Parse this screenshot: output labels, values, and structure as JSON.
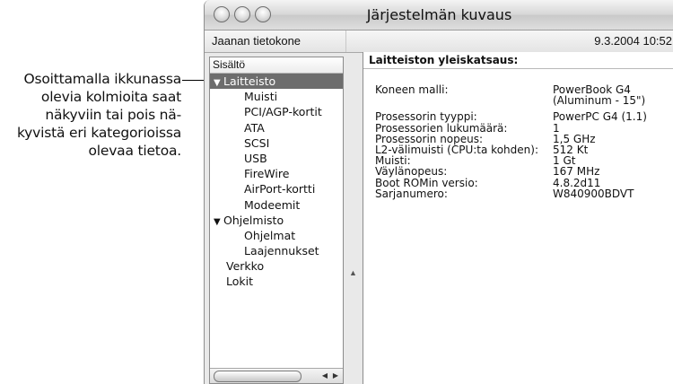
{
  "callout": {
    "lines": [
      "Osoittamalla ikkunassa",
      "olevia kolmioita saat",
      "näkyviin tai pois nä-",
      "kyvistä eri kategorioissa",
      "olevaa tietoa."
    ]
  },
  "window": {
    "title": "Järjestelmän kuvaus",
    "computer_name": "Jaanan tietokone",
    "datetime": "9.3.2004 10:52"
  },
  "sidebar": {
    "header": "Sisältö",
    "items": [
      {
        "label": "Laitteisto",
        "level": 0,
        "expanded": true,
        "selected": true
      },
      {
        "label": "Muisti",
        "level": 1
      },
      {
        "label": "PCI/AGP-kortit",
        "level": 1
      },
      {
        "label": "ATA",
        "level": 1
      },
      {
        "label": "SCSI",
        "level": 1
      },
      {
        "label": "USB",
        "level": 1
      },
      {
        "label": "FireWire",
        "level": 1
      },
      {
        "label": "AirPort-kortti",
        "level": 1
      },
      {
        "label": "Modeemit",
        "level": 1
      },
      {
        "label": "Ohjelmisto",
        "level": 0,
        "expanded": true
      },
      {
        "label": "Ohjelmat",
        "level": 1
      },
      {
        "label": "Laajennukset",
        "level": 1
      },
      {
        "label": "Verkko",
        "level": 0
      },
      {
        "label": "Lokit",
        "level": 0
      }
    ]
  },
  "detail": {
    "header": "Laitteiston yleiskatsaus:",
    "rows": [
      {
        "label": "Koneen malli:",
        "value": "PowerBook G4"
      },
      {
        "label": "",
        "value": "(Aluminum - 15\")"
      },
      {
        "label": "Prosessorin tyyppi:",
        "value": "PowerPC G4  (1.1)"
      },
      {
        "label": "Prosessorien lukumäärä:",
        "value": "1"
      },
      {
        "label": "Prosessorin nopeus:",
        "value": "1,5 GHz"
      },
      {
        "label": "L2-välimuisti (CPU:ta kohden):",
        "value": "512 Kt"
      },
      {
        "label": "Muisti:",
        "value": "1 Gt"
      },
      {
        "label": "Väylänopeus:",
        "value": "167 MHz"
      },
      {
        "label": "Boot ROMin versio:",
        "value": "4.8.2d11"
      },
      {
        "label": "Sarjanumero:",
        "value": "W840900BDVT"
      }
    ]
  },
  "icons": {
    "expanded_triangle": "▼",
    "scroll_left": "◀",
    "scroll_right": "▶",
    "splitter_grip": "▲"
  }
}
